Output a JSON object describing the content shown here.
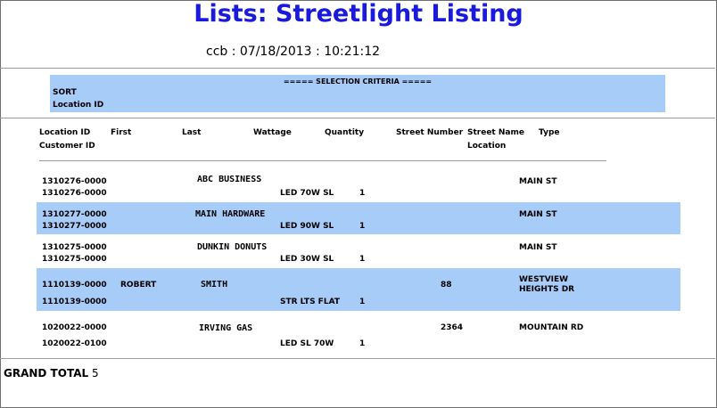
{
  "report": {
    "title": "Lists: Streetlight Listing",
    "run_line": "ccb : 07/18/2013 : 10:21:12"
  },
  "criteria": {
    "heading": "===== SELECTION CRITERIA =====",
    "sort_label": "SORT",
    "location_label": "Location ID"
  },
  "columns": {
    "location_id": "Location ID",
    "first": "First",
    "last": "Last",
    "wattage": "Wattage",
    "quantity": "Quantity",
    "street_number": "Street Number",
    "street_name": "Street Name",
    "type": "Type",
    "customer_id": "Customer ID",
    "location": "Location"
  },
  "records": [
    {
      "location_id": "1310276-0000",
      "customer_id": "1310276-0000",
      "first": "",
      "last": "ABC BUSINESS",
      "wattage": "LED 70W SL",
      "quantity": "1",
      "street_number": "",
      "street_name": "MAIN ST",
      "highlighted": false
    },
    {
      "location_id": "1310277-0000",
      "customer_id": "1310277-0000",
      "first": "",
      "last": "MAIN HARDWARE",
      "wattage": "LED 90W SL",
      "quantity": "1",
      "street_number": "",
      "street_name": "MAIN ST",
      "highlighted": true
    },
    {
      "location_id": "1310275-0000",
      "customer_id": "1310275-0000",
      "first": "",
      "last": "DUNKIN DONUTS",
      "wattage": "LED 30W SL",
      "quantity": "1",
      "street_number": "",
      "street_name": "MAIN ST",
      "highlighted": false
    },
    {
      "location_id": "1110139-0000",
      "customer_id": "1110139-0000",
      "first": "ROBERT",
      "last": "SMITH",
      "wattage": "STR LTS FLAT",
      "quantity": "1",
      "street_number": "88",
      "street_name": "WESTVIEW HEIGHTS DR",
      "highlighted": true
    },
    {
      "location_id": "1020022-0000",
      "customer_id": "1020022-0100",
      "first": "",
      "last": "IRVING GAS",
      "wattage": "LED SL 70W",
      "quantity": "1",
      "street_number": "2364",
      "street_name": "MOUNTAIN RD",
      "highlighted": false
    }
  ],
  "grand_total": {
    "label": "GRAND TOTAL",
    "value": "5"
  },
  "colors": {
    "title": "#1a1adc",
    "band": "#a6ccf7"
  }
}
